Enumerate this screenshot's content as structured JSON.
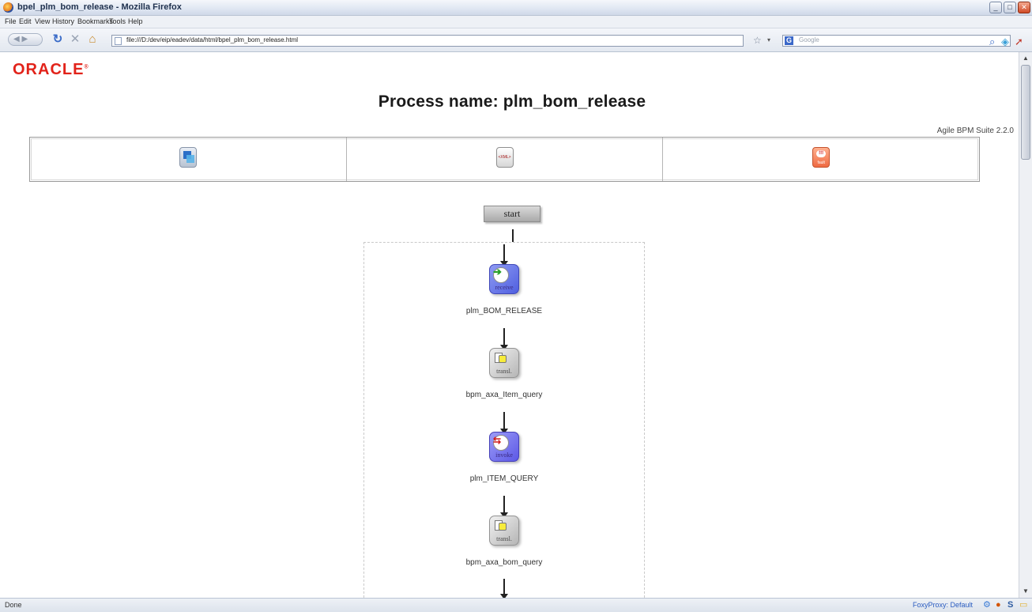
{
  "window": {
    "title": "bpel_plm_bom_release - Mozilla Firefox",
    "minimize_glyph": "_",
    "maximize_glyph": "□",
    "close_glyph": "✕"
  },
  "menu": [
    "File",
    "Edit",
    "View",
    "History",
    "Bookmarks",
    "Tools",
    "Help"
  ],
  "nav": {
    "url": "file:///D:/dev/eip/eadev/data/html/bpel_plm_bom_release.html",
    "search_engine": "G",
    "search_placeholder": "Google",
    "icons": [
      "back-icon",
      "forward-icon",
      "reload-icon",
      "stop-icon",
      "home-icon",
      "bookmark-star-icon",
      "search-icon"
    ]
  },
  "page": {
    "logo": "ORACLE",
    "title": "Process name: plm_bom_release",
    "suite": "Agile BPM Suite 2.2.0",
    "tabs": [
      {
        "name": "diagram",
        "icon": "process-diagram-icon"
      },
      {
        "name": "xml",
        "icon": "xml-source-icon",
        "label": "<XML>"
      },
      {
        "name": "fault",
        "icon": "fault-icon",
        "badge": "!!!",
        "label": "fault"
      }
    ]
  },
  "flow": {
    "start": "start",
    "activities": [
      {
        "type": "receive",
        "label": "plm_BOM_RELEASE"
      },
      {
        "type": "transl.",
        "label": "bpm_axa_Item_query"
      },
      {
        "type": "invoke",
        "label": "plm_ITEM_QUERY"
      },
      {
        "type": "transl.",
        "label": "bpm_axa_bom_query"
      }
    ]
  },
  "status": {
    "text": "Done",
    "proxy": "FoxyProxy: Default"
  }
}
